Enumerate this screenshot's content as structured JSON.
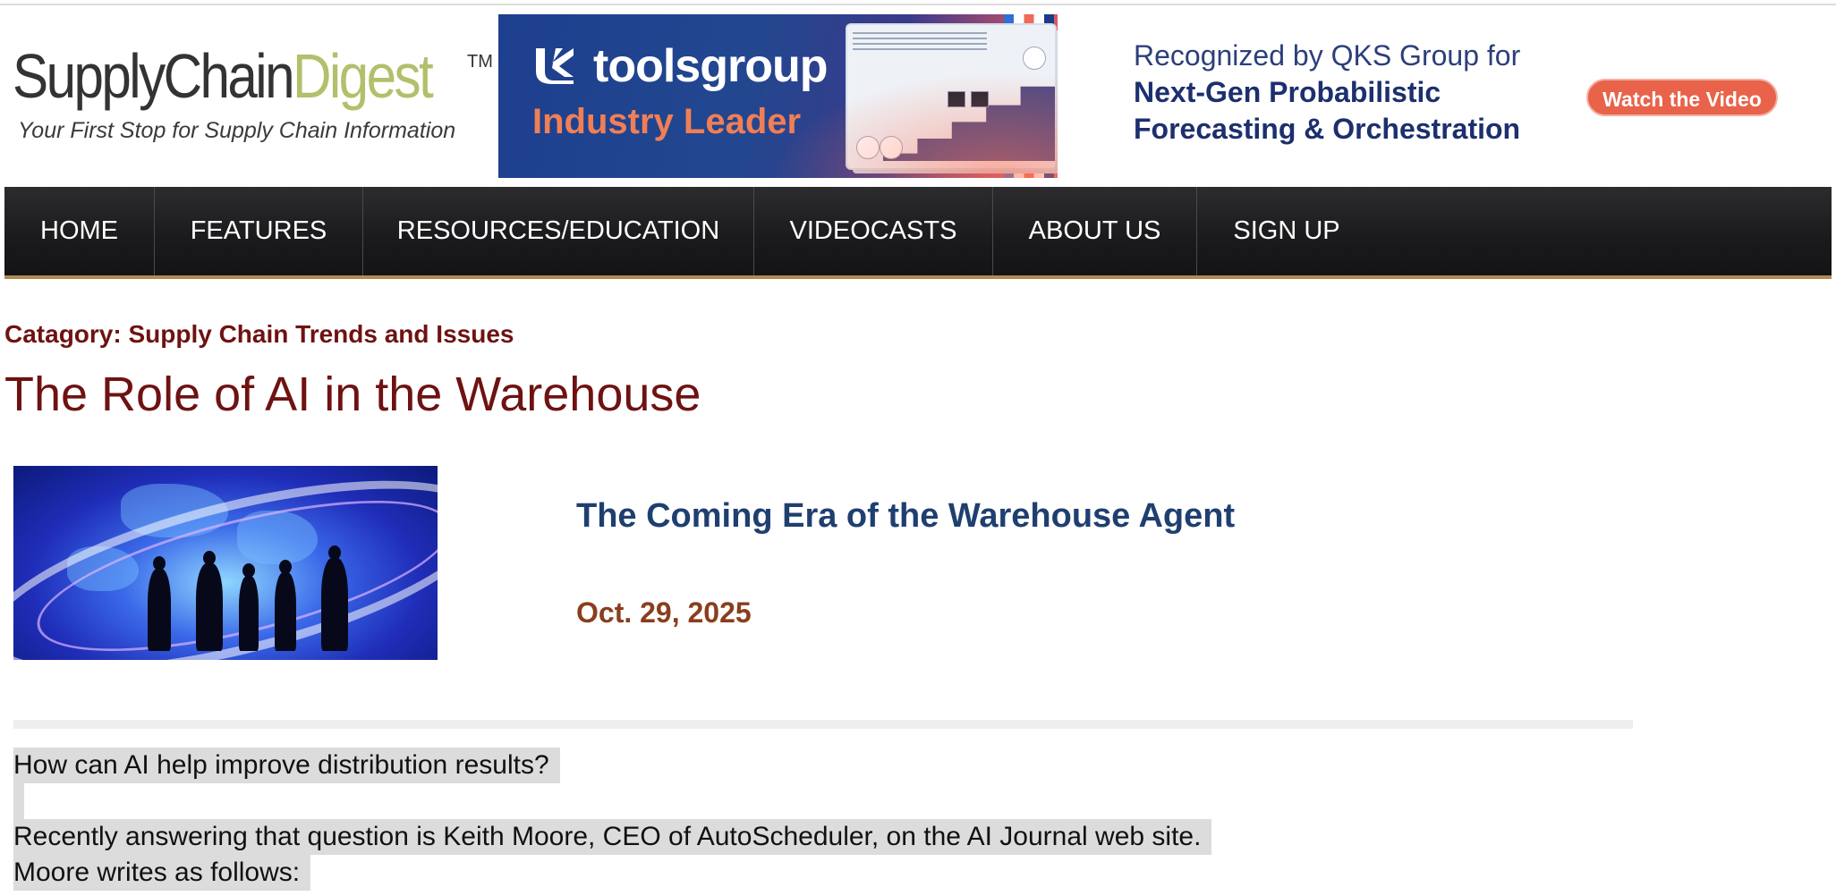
{
  "logo": {
    "name_part1": "SupplyChain",
    "name_part2": "Digest",
    "trademark": "TM",
    "tagline": "Your First Stop for Supply Chain Information"
  },
  "ad": {
    "brand": "toolsgroup",
    "subtitle": "Industry Leader",
    "line1": "Recognized by QKS Group for",
    "line2": "Next-Gen Probabilistic",
    "line3": "Forecasting & Orchestration",
    "button": "Watch the Video"
  },
  "nav": {
    "items": [
      "HOME",
      "FEATURES",
      "RESOURCES/EDUCATION",
      "VIDEOCASTS",
      "ABOUT US",
      "SIGN UP"
    ]
  },
  "content": {
    "category": "Catagory: Supply Chain Trends and Issues",
    "page_title": "The Role of AI in the Warehouse",
    "article_title": "The Coming Era of the Warehouse Agent",
    "article_date": "Oct. 29, 2025",
    "paragraphs": [
      "How can AI help improve distribution results?",
      "Recently answering that question is Keith Moore, CEO of AutoScheduler, on the AI Journal web site.",
      "Moore writes as follows:"
    ]
  },
  "colors": {
    "brand_dark": "#6e1212",
    "title_blue": "#1f3f70",
    "date_brown": "#8a3e1d",
    "nav_bg": "#1a1a1c",
    "ad_button": "#e8634a"
  }
}
